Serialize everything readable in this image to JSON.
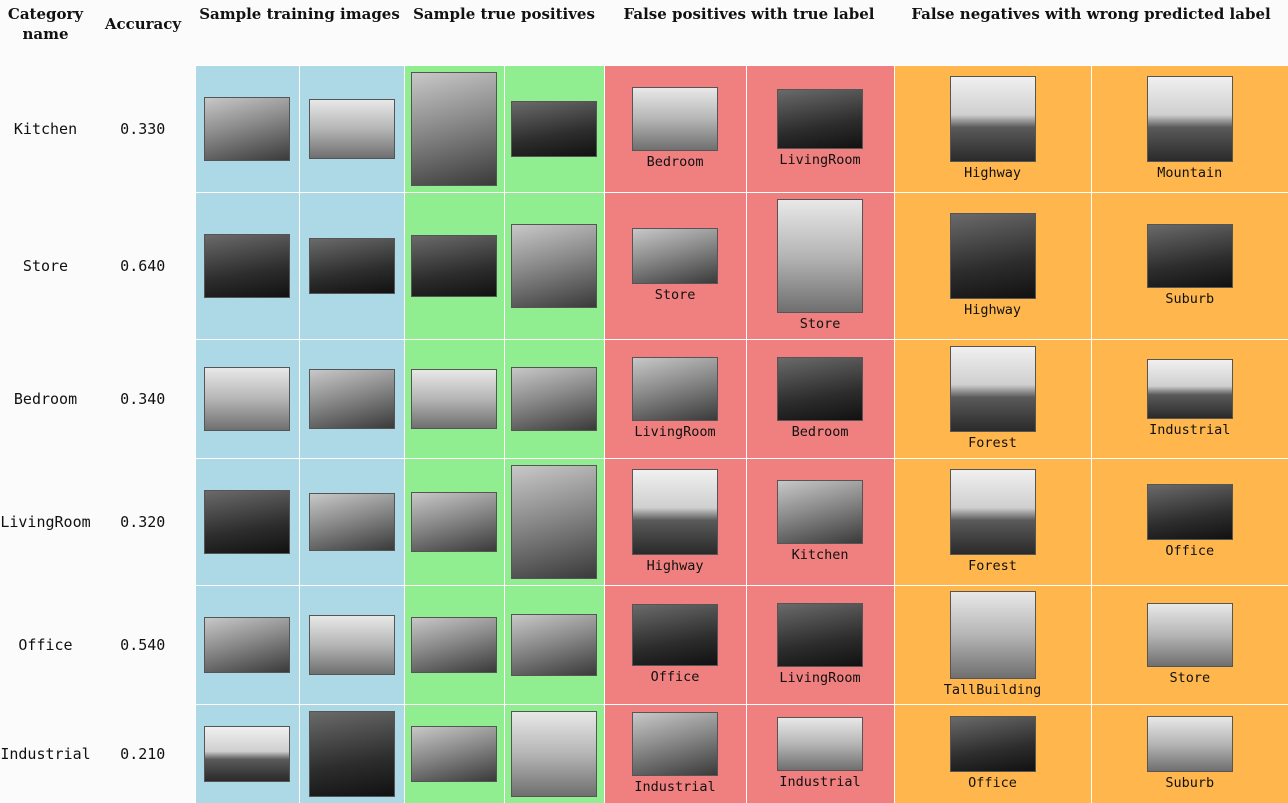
{
  "headers": {
    "category": "Category name",
    "accuracy": "Accuracy",
    "training": "Sample training images",
    "true_pos": "Sample true positives",
    "false_pos": "False positives with true label",
    "false_neg": "False negatives with wrong predicted label"
  },
  "colors": {
    "training": "#add8e6",
    "true_pos": "#90ee90",
    "false_pos": "#f08080",
    "false_neg": "#ffb74d"
  },
  "rows": [
    {
      "category": "Kitchen",
      "accuracy": "0.330",
      "fp": [
        "Bedroom",
        "LivingRoom"
      ],
      "fn": [
        "Highway",
        "Mountain"
      ]
    },
    {
      "category": "Store",
      "accuracy": "0.640",
      "fp": [
        "Store",
        "Store"
      ],
      "fn": [
        "Highway",
        "Suburb"
      ]
    },
    {
      "category": "Bedroom",
      "accuracy": "0.340",
      "fp": [
        "LivingRoom",
        "Bedroom"
      ],
      "fn": [
        "Forest",
        "Industrial"
      ]
    },
    {
      "category": "LivingRoom",
      "accuracy": "0.320",
      "fp": [
        "Highway",
        "Kitchen"
      ],
      "fn": [
        "Forest",
        "Office"
      ]
    },
    {
      "category": "Office",
      "accuracy": "0.540",
      "fp": [
        "Office",
        "LivingRoom"
      ],
      "fn": [
        "TallBuilding",
        "Store"
      ]
    },
    {
      "category": "Industrial",
      "accuracy": "0.210",
      "fp": [
        "Industrial",
        "Industrial"
      ],
      "fn": [
        "Office",
        "Suburb"
      ]
    }
  ]
}
